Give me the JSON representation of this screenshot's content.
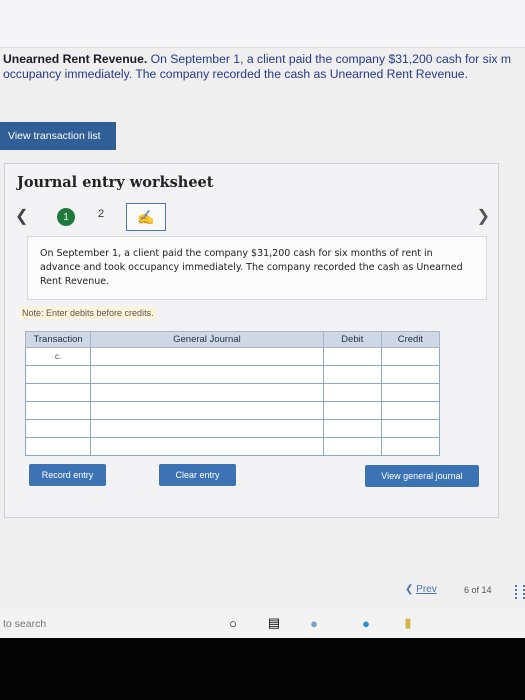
{
  "intro": {
    "bold": "Unearned Rent Revenue.",
    "rest": " On September 1, a client paid the company $31,200 cash for six m",
    "line2": "occupancy immediately. The company recorded the cash as Unearned Rent Revenue."
  },
  "view_transaction_list": "View transaction list",
  "worksheet": {
    "title": "Journal entry worksheet",
    "steps": {
      "done": "1",
      "next": "2"
    },
    "description": "On September 1, a client paid the company $31,200 cash for six months of rent in advance and took occupancy immediately. The company recorded the cash as Unearned Rent Revenue.",
    "note": "Note: Enter debits before credits.",
    "table": {
      "headers": [
        "Transaction",
        "General Journal",
        "Debit",
        "Credit"
      ],
      "first_transaction": "c."
    },
    "buttons": {
      "record": "Record entry",
      "clear": "Clear entry",
      "view": "View general journal"
    }
  },
  "pagination": {
    "prev": "Prev",
    "page": "6 of 14"
  },
  "taskbar": {
    "search": "to search"
  },
  "icons": [
    "chevron-left-icon",
    "chevron-right-icon",
    "hand-cursor-icon",
    "grid-icon",
    "cortana-icon",
    "task-view-icon",
    "chrome-icon",
    "edge-icon",
    "file-explorer-icon"
  ]
}
